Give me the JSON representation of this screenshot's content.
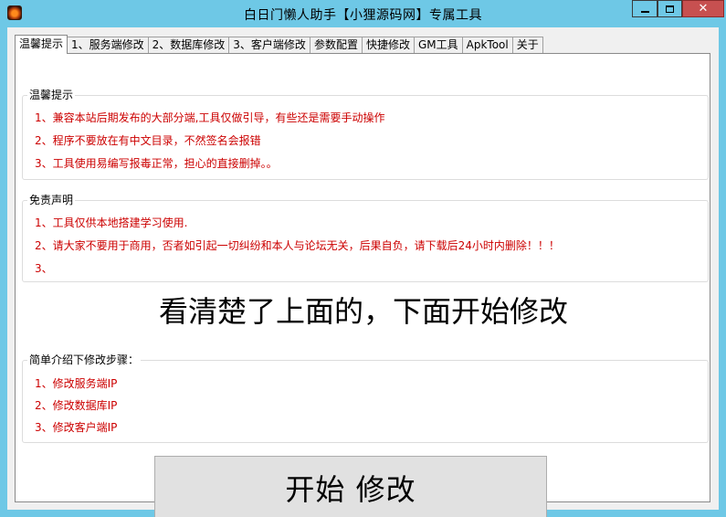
{
  "window": {
    "title": "白日门懒人助手【小狸源码网】专属工具",
    "close_glyph": "✕"
  },
  "tabs": [
    {
      "label": "温馨提示"
    },
    {
      "label": "1、服务端修改"
    },
    {
      "label": "2、数据库修改"
    },
    {
      "label": "3、客户端修改"
    },
    {
      "label": "参数配置"
    },
    {
      "label": "快捷修改"
    },
    {
      "label": "GM工具"
    },
    {
      "label": "ApkTool"
    },
    {
      "label": "关于"
    }
  ],
  "tips": {
    "title": "温馨提示",
    "lines": [
      "1、兼容本站后期发布的大部分端,工具仅做引导，有些还是需要手动操作",
      "2、程序不要放在有中文目录，不然签名会报错",
      "3、工具使用易编写报毒正常，担心的直接删掉。。"
    ]
  },
  "disclaimer": {
    "title": "免责声明",
    "lines": [
      "1、工具仅供本地搭建学习使用.",
      "2、请大家不要用于商用，否者如引起一切纠纷和本人与论坛无关，后果自负，请下载后24小时内删除！！！",
      "3、"
    ]
  },
  "headline": "看清楚了上面的，下面开始修改",
  "steps": {
    "title": "简单介绍下修改步骤：",
    "lines": [
      "1、修改服务端IP",
      "2、修改数据库IP",
      "3、修改客户端IP"
    ]
  },
  "start_button": {
    "label": "开始 修改"
  },
  "colors": {
    "titlebar": "#6ec8e6",
    "close_button": "#c75050",
    "note_text": "#cc0000"
  }
}
